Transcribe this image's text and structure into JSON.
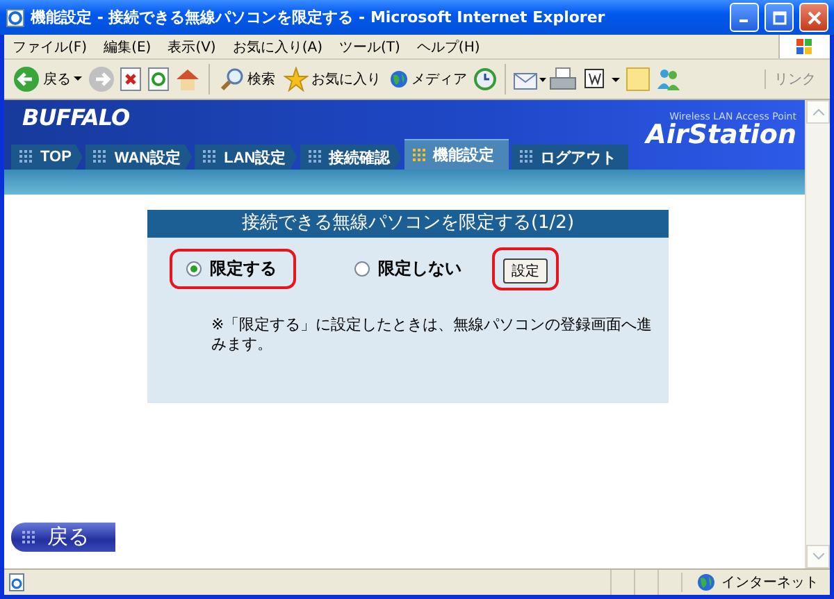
{
  "window": {
    "title": "機能設定 - 接続できる無線パソコンを限定する - Microsoft Internet Explorer"
  },
  "menu": [
    "ファイル(F)",
    "編集(E)",
    "表示(V)",
    "お気に入り(A)",
    "ツール(T)",
    "ヘルプ(H)"
  ],
  "toolbar": {
    "back": "戻る",
    "search": "検索",
    "favorites": "お気に入り",
    "media": "メディア",
    "links": "リンク"
  },
  "site": {
    "logo": "BUFFALO",
    "product_line": "Wireless LAN Access Point",
    "product": "AirStation",
    "tabs": [
      {
        "label": "TOP",
        "selected": false
      },
      {
        "label": "WAN設定",
        "selected": false
      },
      {
        "label": "LAN設定",
        "selected": false
      },
      {
        "label": "接続確認",
        "selected": false
      },
      {
        "label": "機能設定",
        "selected": true
      },
      {
        "label": "ログアウト",
        "selected": false
      }
    ]
  },
  "panel": {
    "title": "接続できる無線パソコンを限定する(1/2)",
    "options": [
      {
        "label": "限定する",
        "selected": true,
        "highlighted": true
      },
      {
        "label": "限定しない",
        "selected": false,
        "highlighted": false
      }
    ],
    "submit": {
      "label": "設定",
      "highlighted": true
    },
    "note": "※「限定する」に設定したときは、無線パソコンの登録画面へ進みます。"
  },
  "back_button": "戻る",
  "status_bar": {
    "zone": "インターネット"
  }
}
